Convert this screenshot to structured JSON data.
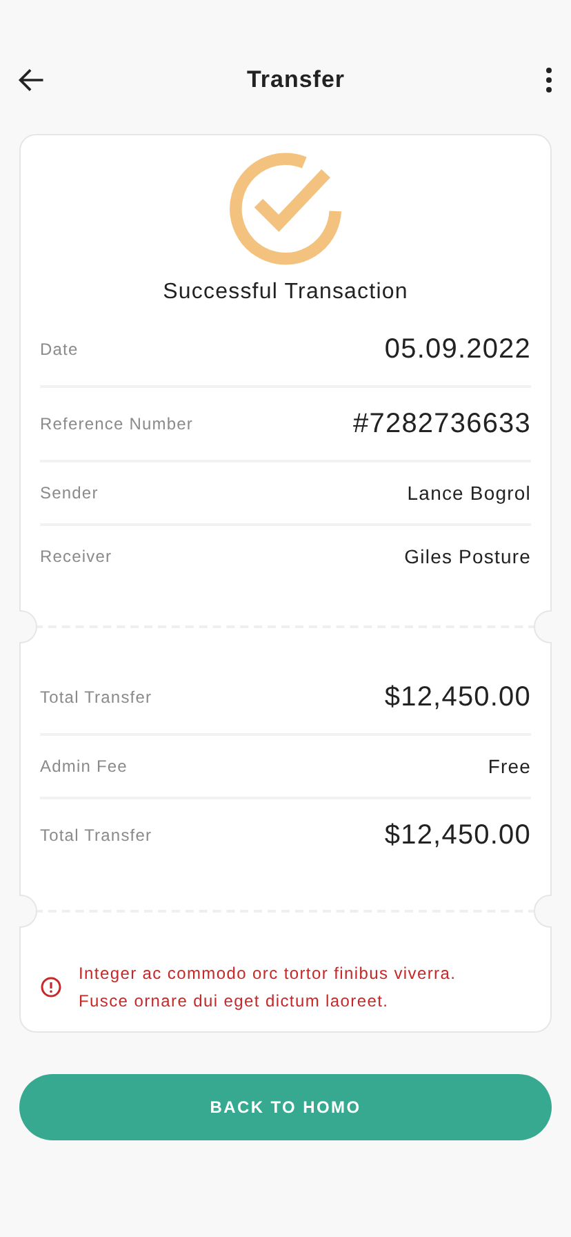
{
  "header": {
    "title": "Transfer"
  },
  "status": {
    "title": "Successful Transaction"
  },
  "details": [
    {
      "label": "Date",
      "value": "05.09.2022",
      "kind": "large"
    },
    {
      "label": "Reference Number",
      "value": "#7282736633",
      "kind": "large"
    },
    {
      "label": "Sender",
      "value": "Lance Bogrol",
      "kind": "small"
    },
    {
      "label": "Receiver",
      "value": "Giles Posture",
      "kind": "small"
    }
  ],
  "amounts": [
    {
      "label": "Total Transfer",
      "value": "$12,450.00",
      "kind": "large"
    },
    {
      "label": "Admin Fee",
      "value": "Free",
      "kind": "small"
    },
    {
      "label": "Total Transfer",
      "value": "$12,450.00",
      "kind": "large"
    }
  ],
  "note": "Integer ac commodo orc tortor finibus viverra. Fusce ornare dui eget dictum laoreet.",
  "button": "BACK TO HOMO"
}
